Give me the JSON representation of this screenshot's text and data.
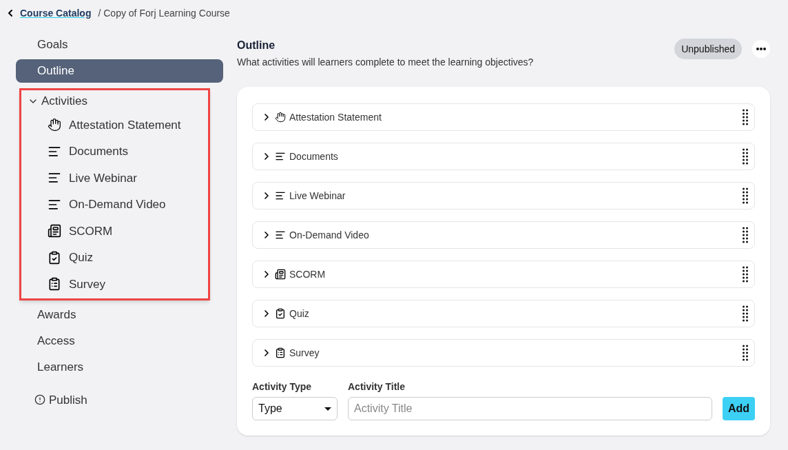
{
  "breadcrumb": {
    "link": "Course Catalog",
    "current": "/ Copy of Forj Learning Course"
  },
  "sidebar": {
    "items": [
      {
        "label": "Goals",
        "selected": false
      },
      {
        "label": "Outline",
        "selected": true
      },
      {
        "label": "Activities",
        "expanded": true,
        "highlighted": true,
        "children": [
          {
            "label": "Attestation Statement",
            "kind": "hand"
          },
          {
            "label": "Documents",
            "kind": "text"
          },
          {
            "label": "Live Webinar",
            "kind": "text"
          },
          {
            "label": "On-Demand Video",
            "kind": "text"
          },
          {
            "label": "SCORM",
            "kind": "scorm"
          },
          {
            "label": "Quiz",
            "kind": "quiz"
          },
          {
            "label": "Survey",
            "kind": "survey"
          }
        ]
      },
      {
        "label": "Awards",
        "selected": false
      },
      {
        "label": "Access",
        "selected": false
      },
      {
        "label": "Learners",
        "selected": false
      }
    ],
    "publish": "Publish"
  },
  "header": {
    "title": "Outline",
    "subtitle": "What activities will learners complete to meet the learning objectives?",
    "status": "Unpublished"
  },
  "activities": [
    {
      "label": "Attestation Statement",
      "kind": "hand",
      "expanded": false
    },
    {
      "label": "Documents",
      "kind": "text",
      "expanded": false
    },
    {
      "label": "Live Webinar",
      "kind": "text",
      "expanded": false
    },
    {
      "label": "On-Demand Video",
      "kind": "text",
      "expanded": false
    },
    {
      "label": "SCORM",
      "kind": "scorm",
      "expanded": false
    },
    {
      "label": "Quiz",
      "kind": "quiz",
      "expanded": false
    },
    {
      "label": "Survey",
      "kind": "survey",
      "expanded": false
    }
  ],
  "form": {
    "type_label": "Activity Type",
    "type_value": "Type",
    "title_label": "Activity Title",
    "title_placeholder": "Activity Title",
    "add": "Add"
  }
}
